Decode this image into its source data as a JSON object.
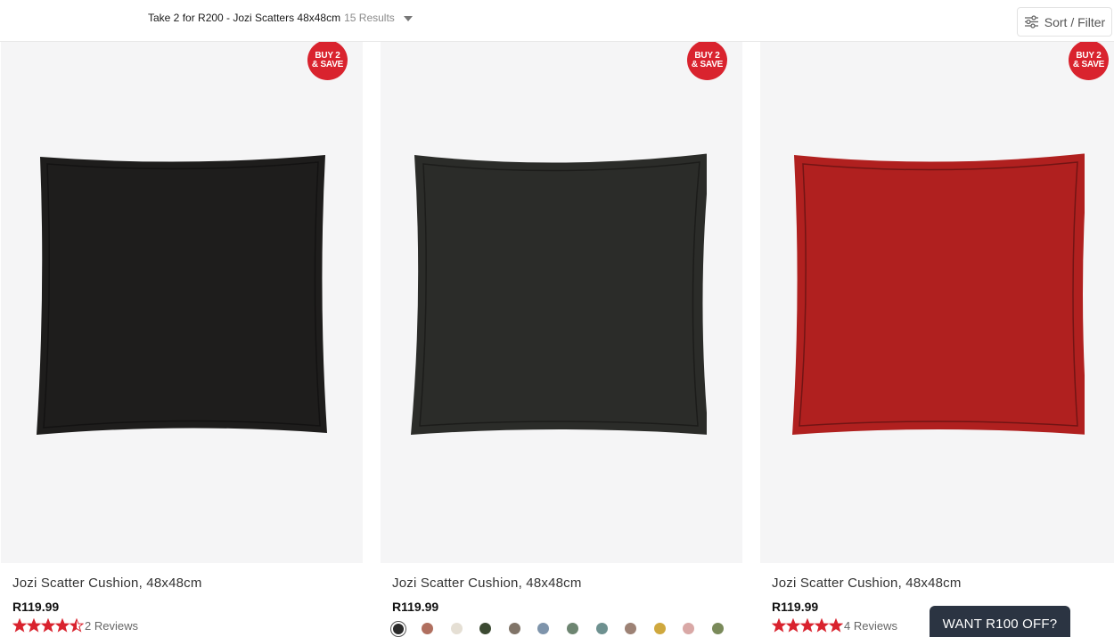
{
  "header": {
    "collection_title": "Take 2 for R200 - Jozi Scatters 48x48cm",
    "results_count": "15 Results",
    "sort_filter_label": "Sort / Filter"
  },
  "products": [
    {
      "badge_line1": "BUY 2",
      "badge_line2": "& SAVE",
      "color": "#1e1d1c",
      "title": "Jozi Scatter Cushion, 48x48cm",
      "price": "R119.99",
      "rating": 4.5,
      "reviews": "2 Reviews"
    },
    {
      "badge_line1": "BUY 2",
      "badge_line2": "& SAVE",
      "color": "#2b2c29",
      "title": "Jozi Scatter Cushion, 48x48cm",
      "price": "R119.99",
      "swatches": [
        "#2a2a2a",
        "#b06f5f",
        "#e5dfd4",
        "#3c4a32",
        "#807468",
        "#7e94ab",
        "#6d8571",
        "#6e9190",
        "#9d8275",
        "#cfa83e",
        "#d9a8a6",
        "#7a8a5a"
      ]
    },
    {
      "badge_line1": "BUY 2",
      "badge_line2": "& SAVE",
      "color": "#b0201f",
      "title": "Jozi Scatter Cushion, 48x48cm",
      "price": "R119.99",
      "rating": 5,
      "reviews": "4 Reviews"
    }
  ],
  "promo": {
    "label": "WANT R100 OFF?"
  },
  "colors": {
    "accent_red": "#d9232e",
    "promo_bg": "#2b3442",
    "star": "#d9232e"
  }
}
